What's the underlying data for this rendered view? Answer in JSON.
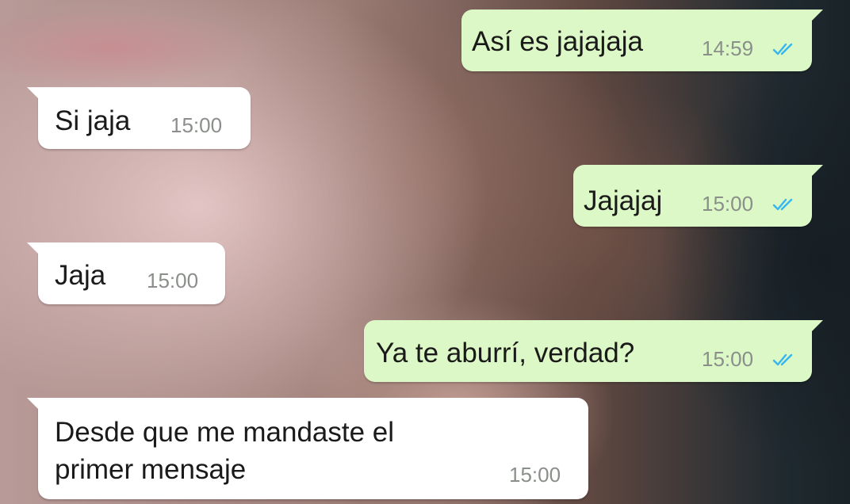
{
  "messages": [
    {
      "direction": "outgoing",
      "text": "Así es jajajaja",
      "time": "14:59",
      "status_icon": "double-check-read-icon"
    },
    {
      "direction": "incoming",
      "text": "Si jaja",
      "time": "15:00"
    },
    {
      "direction": "outgoing",
      "text": "Jajajaj",
      "time": "15:00",
      "status_icon": "double-check-read-icon"
    },
    {
      "direction": "incoming",
      "text": "Jaja",
      "time": "15:00"
    },
    {
      "direction": "outgoing",
      "text": "Ya te aburrí, verdad?",
      "time": "15:00",
      "status_icon": "double-check-read-icon"
    },
    {
      "direction": "incoming",
      "text_lines": [
        "Desde que me mandaste el",
        "primer mensaje"
      ],
      "time": "15:00"
    }
  ],
  "colors": {
    "outgoing_bubble": "#dcf8c6",
    "incoming_bubble": "#ffffff",
    "read_ticks": "#34b7f1",
    "time_text": "#8a8f8a"
  }
}
